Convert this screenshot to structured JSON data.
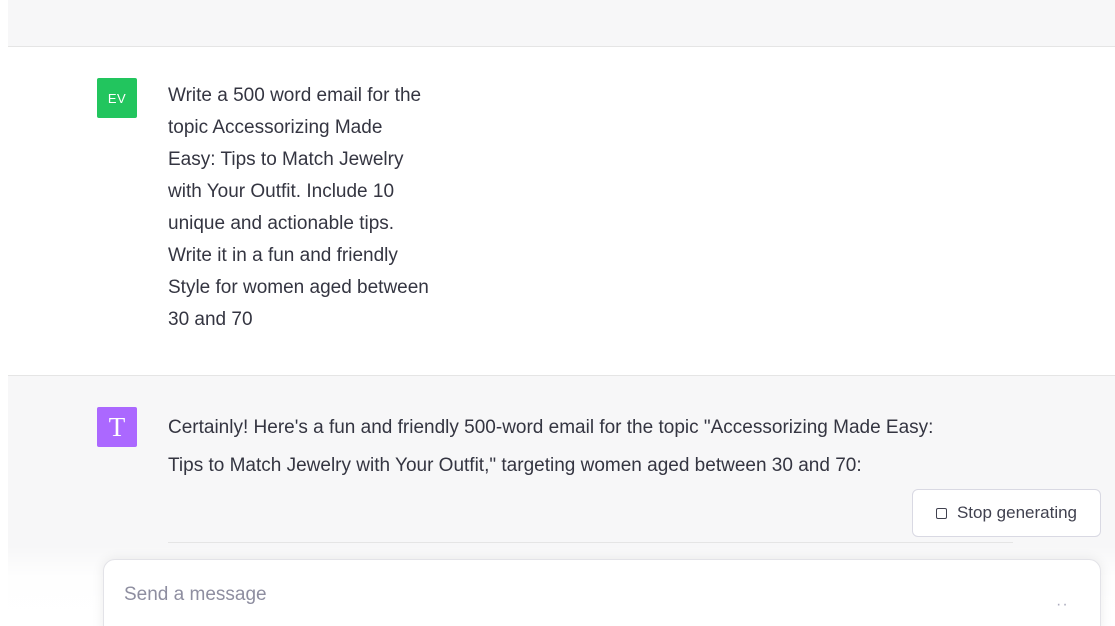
{
  "conversation": {
    "user_message": {
      "avatar_initials": "EV",
      "avatar_color": "#22c55e",
      "text": "Write a 500 word email for the\ntopic Accessorizing Made\nEasy: Tips to Match Jewelry\nwith Your Outfit. Include 10\nunique and actionable tips.\nWrite it in a fun and friendly\nStyle for women aged between\n30 and 70"
    },
    "assistant_message": {
      "avatar_letter": "T",
      "avatar_color": "#ab68ff",
      "text": "Certainly! Here's a fun and friendly 500-word email for the topic \"Accessorizing Made Easy:\nTips to Match Jewelry with Your Outfit,\" targeting women aged between 30 and 70:"
    }
  },
  "controls": {
    "stop_label": "Stop generating",
    "stop_icon": "square-stop-icon"
  },
  "composer": {
    "placeholder": "Send a message",
    "value": "",
    "typing_indicator": "··"
  },
  "colors": {
    "band_background": "#f7f7f8",
    "text": "#343541"
  }
}
